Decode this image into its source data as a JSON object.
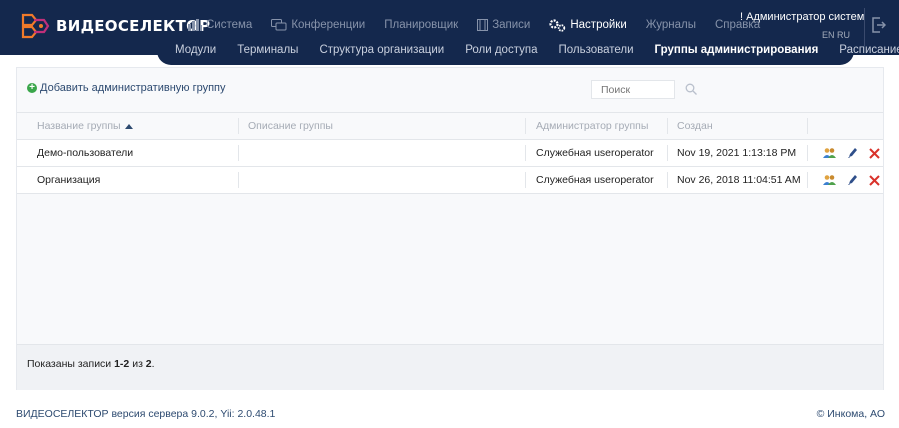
{
  "brand": {
    "name": "ВИДЕОСЕЛЕКТОР"
  },
  "topnav": [
    {
      "label": "Система",
      "icon": "chart-icon",
      "active": false
    },
    {
      "label": "Конференции",
      "icon": "chat-icon",
      "active": false
    },
    {
      "label": "Планировщик",
      "icon": "",
      "active": false
    },
    {
      "label": "Записи",
      "icon": "film-icon",
      "active": false
    },
    {
      "label": "Настройки",
      "icon": "gears-icon",
      "active": true
    },
    {
      "label": "Журналы",
      "icon": "",
      "active": false
    },
    {
      "label": "Справка",
      "icon": "",
      "active": false
    }
  ],
  "user": {
    "name": "! Администратор систем",
    "lang": "EN RU"
  },
  "subnav": [
    {
      "label": "Модули",
      "active": false
    },
    {
      "label": "Терминалы",
      "active": false
    },
    {
      "label": "Структура организации",
      "active": false
    },
    {
      "label": "Роли доступа",
      "active": false
    },
    {
      "label": "Пользователи",
      "active": false
    },
    {
      "label": "Группы администрирования",
      "active": true
    },
    {
      "label": "Расписание",
      "active": false
    }
  ],
  "page": {
    "add_label": "Добавить административную группу",
    "search_placeholder": "Поиск"
  },
  "table": {
    "columns": [
      "Название группы",
      "Описание группы",
      "Администратор группы",
      "Создан"
    ],
    "rows": [
      {
        "name": "Демо-пользователи",
        "description": "",
        "admin": "Служебная useroperator",
        "created": "Nov 19, 2021 1:13:18 PM"
      },
      {
        "name": "Организация",
        "description": "",
        "admin": "Служебная useroperator",
        "created": "Nov 26, 2018 11:04:51 AM"
      }
    ]
  },
  "summary": {
    "prefix": "Показаны записи ",
    "range": "1-2",
    "middle": " из ",
    "total": "2",
    "suffix": "."
  },
  "footer": {
    "left": "ВИДЕОСЕЛЕКТОР версия сервера 9.0.2, Yii: 2.0.48.1",
    "right": "© Инкома, АО"
  },
  "colors": {
    "header_bg": "#14284d",
    "accent_orange": "#f07a2a",
    "add_green": "#3aa64a",
    "delete_red": "#d9322b"
  }
}
